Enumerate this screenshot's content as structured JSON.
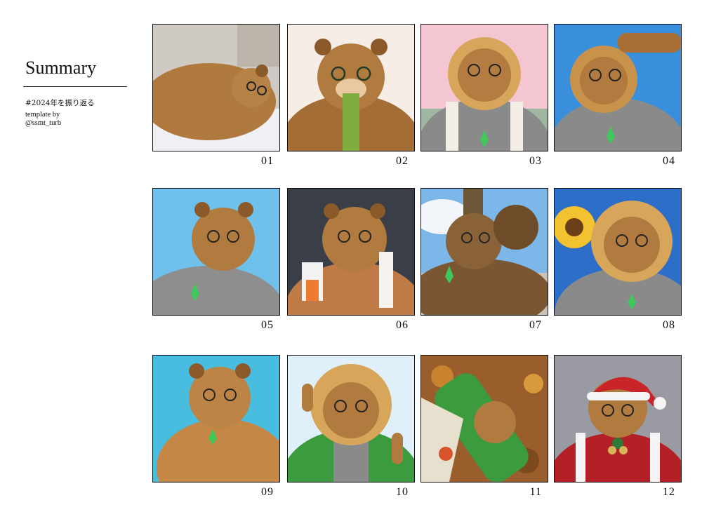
{
  "sidebar": {
    "title": "Summary",
    "hashtag": "#2024年を振り返る",
    "credit_line1": "template by",
    "credit_line2": "@ssmt_turb"
  },
  "grid": {
    "months": [
      {
        "number": "01",
        "scene": "bed"
      },
      {
        "number": "02",
        "scene": "towel"
      },
      {
        "number": "03",
        "scene": "sakura"
      },
      {
        "number": "04",
        "scene": "salute"
      },
      {
        "number": "05",
        "scene": "sky"
      },
      {
        "number": "06",
        "scene": "wink"
      },
      {
        "number": "07",
        "scene": "relax"
      },
      {
        "number": "08",
        "scene": "sunflower"
      },
      {
        "number": "09",
        "scene": "pool"
      },
      {
        "number": "10",
        "scene": "peace"
      },
      {
        "number": "11",
        "scene": "autumn"
      },
      {
        "number": "12",
        "scene": "santa"
      }
    ]
  },
  "colors": {
    "fur": "#b07a3e",
    "fur_dark": "#7a4f22",
    "shirt_gray": "#8a8a8a",
    "sky": "#3a8fdc",
    "sakura": "#f3c6d2",
    "pool": "#48bde0",
    "santa_red": "#b32025"
  }
}
